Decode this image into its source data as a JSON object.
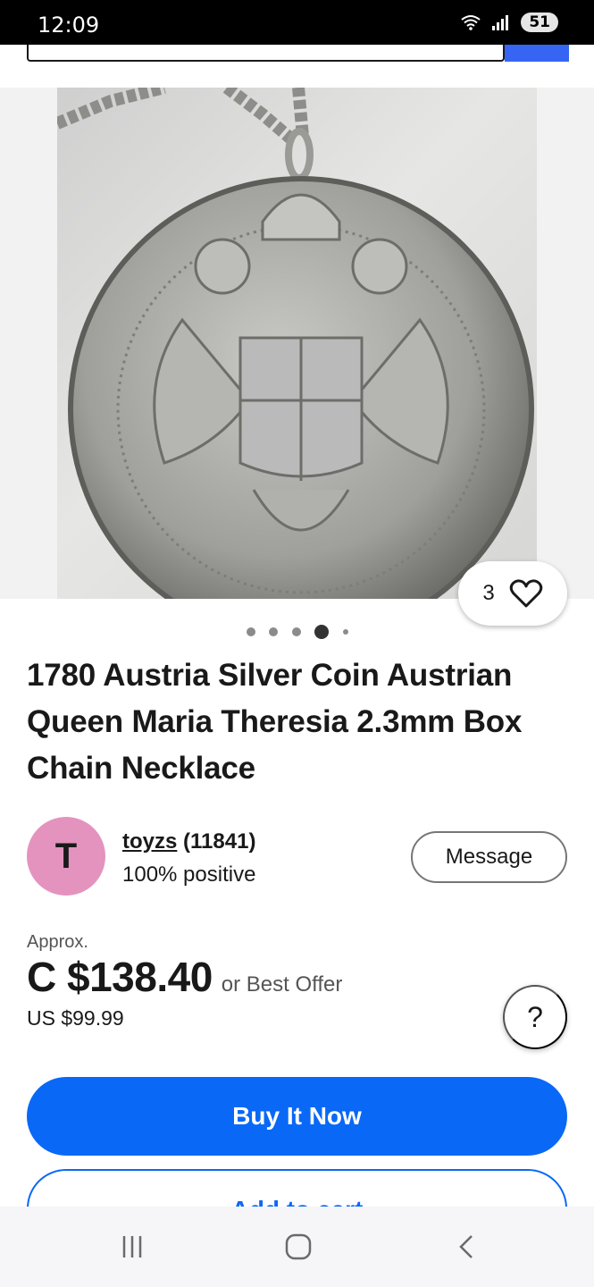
{
  "status_bar": {
    "time": "12:09",
    "battery": "51",
    "icons": [
      "wifi-icon",
      "signal-icon",
      "battery-icon"
    ]
  },
  "listing": {
    "image": {
      "subject": "silver-coin-necklace-photo",
      "like_count": "3",
      "pager": {
        "total": 5,
        "active": 4
      }
    },
    "title": "1780 Austria Silver Coin Austrian Queen Maria Theresia 2.3mm Box Chain Necklace",
    "seller": {
      "avatar_letter": "T",
      "avatar_color": "#e493bf",
      "name": "toyzs",
      "score": "(11841)",
      "feedback": "100% positive",
      "message_label": "Message"
    },
    "price": {
      "approx_label": "Approx.",
      "main": "C $138.40",
      "offer": "or Best Offer",
      "usd": "US $99.99",
      "help_label": "?"
    },
    "actions": {
      "buy_label": "Buy It Now",
      "cart_label": "Add to cart"
    }
  },
  "colors": {
    "accent": "#0968f6",
    "search_button": "#3665f3"
  },
  "nav_bar": {
    "icons": [
      "recent-apps-icon",
      "home-icon",
      "back-icon"
    ]
  }
}
